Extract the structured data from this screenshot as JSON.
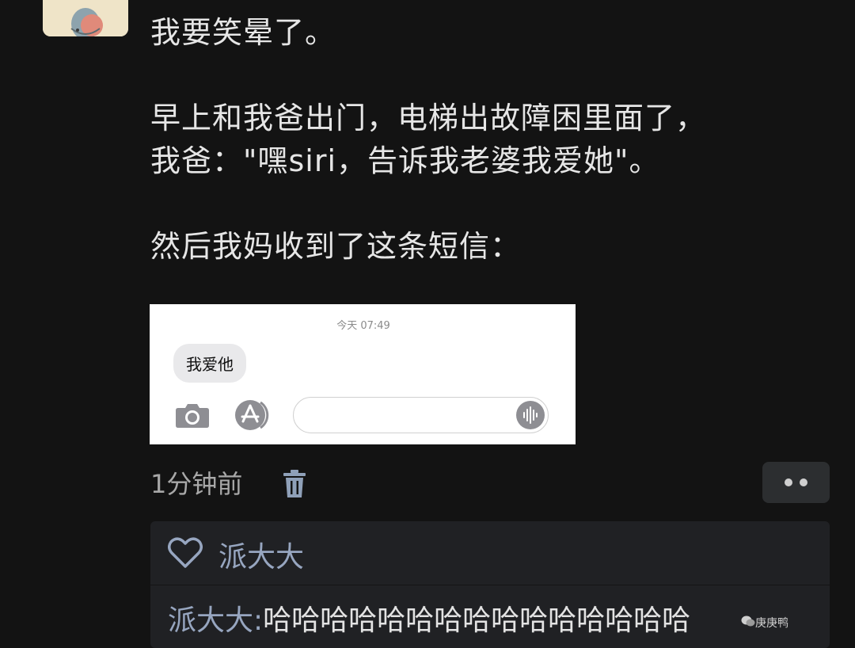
{
  "post": {
    "lines": [
      "我要笑晕了。",
      "早上和我爸出门，电梯出故障困里面了，",
      "我爸：\"嘿siri，告诉我老婆我爱她\"。",
      "然后我妈收到了这条短信："
    ]
  },
  "embedded_screenshot": {
    "timestamp": "今天 07:49",
    "message": "我爱他",
    "icons": [
      "camera-icon",
      "app-store-icon",
      "audio-waveform-icon"
    ]
  },
  "meta": {
    "time_ago": "1分钟前",
    "delete_icon": "trash-icon",
    "more_icon": "more-dots-icon"
  },
  "comments": {
    "like_icon": "heart-icon",
    "liked_by": "派大大",
    "items": [
      {
        "author": "派大大:",
        "text": "哈哈哈哈哈哈哈哈哈哈哈哈哈哈哈"
      }
    ]
  },
  "watermark": {
    "icon": "wechat-icon",
    "text": "庚庚鸭"
  },
  "colors": {
    "background": "#131313",
    "panel": "#202124",
    "name_link": "#97a6c0",
    "text": "#e6e6e6"
  }
}
